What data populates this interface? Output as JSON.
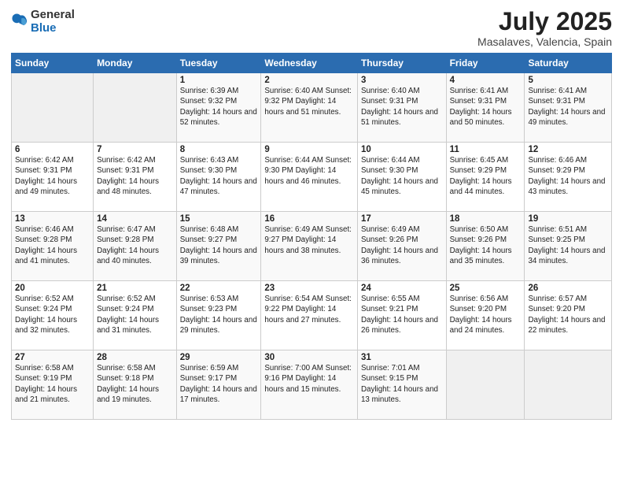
{
  "header": {
    "logo_general": "General",
    "logo_blue": "Blue",
    "main_title": "July 2025",
    "subtitle": "Masalaves, Valencia, Spain"
  },
  "columns": [
    "Sunday",
    "Monday",
    "Tuesday",
    "Wednesday",
    "Thursday",
    "Friday",
    "Saturday"
  ],
  "rows": [
    [
      {
        "day": "",
        "info": ""
      },
      {
        "day": "",
        "info": ""
      },
      {
        "day": "1",
        "info": "Sunrise: 6:39 AM\nSunset: 9:32 PM\nDaylight: 14 hours and 52 minutes."
      },
      {
        "day": "2",
        "info": "Sunrise: 6:40 AM\nSunset: 9:32 PM\nDaylight: 14 hours and 51 minutes."
      },
      {
        "day": "3",
        "info": "Sunrise: 6:40 AM\nSunset: 9:31 PM\nDaylight: 14 hours and 51 minutes."
      },
      {
        "day": "4",
        "info": "Sunrise: 6:41 AM\nSunset: 9:31 PM\nDaylight: 14 hours and 50 minutes."
      },
      {
        "day": "5",
        "info": "Sunrise: 6:41 AM\nSunset: 9:31 PM\nDaylight: 14 hours and 49 minutes."
      }
    ],
    [
      {
        "day": "6",
        "info": "Sunrise: 6:42 AM\nSunset: 9:31 PM\nDaylight: 14 hours and 49 minutes."
      },
      {
        "day": "7",
        "info": "Sunrise: 6:42 AM\nSunset: 9:31 PM\nDaylight: 14 hours and 48 minutes."
      },
      {
        "day": "8",
        "info": "Sunrise: 6:43 AM\nSunset: 9:30 PM\nDaylight: 14 hours and 47 minutes."
      },
      {
        "day": "9",
        "info": "Sunrise: 6:44 AM\nSunset: 9:30 PM\nDaylight: 14 hours and 46 minutes."
      },
      {
        "day": "10",
        "info": "Sunrise: 6:44 AM\nSunset: 9:30 PM\nDaylight: 14 hours and 45 minutes."
      },
      {
        "day": "11",
        "info": "Sunrise: 6:45 AM\nSunset: 9:29 PM\nDaylight: 14 hours and 44 minutes."
      },
      {
        "day": "12",
        "info": "Sunrise: 6:46 AM\nSunset: 9:29 PM\nDaylight: 14 hours and 43 minutes."
      }
    ],
    [
      {
        "day": "13",
        "info": "Sunrise: 6:46 AM\nSunset: 9:28 PM\nDaylight: 14 hours and 41 minutes."
      },
      {
        "day": "14",
        "info": "Sunrise: 6:47 AM\nSunset: 9:28 PM\nDaylight: 14 hours and 40 minutes."
      },
      {
        "day": "15",
        "info": "Sunrise: 6:48 AM\nSunset: 9:27 PM\nDaylight: 14 hours and 39 minutes."
      },
      {
        "day": "16",
        "info": "Sunrise: 6:49 AM\nSunset: 9:27 PM\nDaylight: 14 hours and 38 minutes."
      },
      {
        "day": "17",
        "info": "Sunrise: 6:49 AM\nSunset: 9:26 PM\nDaylight: 14 hours and 36 minutes."
      },
      {
        "day": "18",
        "info": "Sunrise: 6:50 AM\nSunset: 9:26 PM\nDaylight: 14 hours and 35 minutes."
      },
      {
        "day": "19",
        "info": "Sunrise: 6:51 AM\nSunset: 9:25 PM\nDaylight: 14 hours and 34 minutes."
      }
    ],
    [
      {
        "day": "20",
        "info": "Sunrise: 6:52 AM\nSunset: 9:24 PM\nDaylight: 14 hours and 32 minutes."
      },
      {
        "day": "21",
        "info": "Sunrise: 6:52 AM\nSunset: 9:24 PM\nDaylight: 14 hours and 31 minutes."
      },
      {
        "day": "22",
        "info": "Sunrise: 6:53 AM\nSunset: 9:23 PM\nDaylight: 14 hours and 29 minutes."
      },
      {
        "day": "23",
        "info": "Sunrise: 6:54 AM\nSunset: 9:22 PM\nDaylight: 14 hours and 27 minutes."
      },
      {
        "day": "24",
        "info": "Sunrise: 6:55 AM\nSunset: 9:21 PM\nDaylight: 14 hours and 26 minutes."
      },
      {
        "day": "25",
        "info": "Sunrise: 6:56 AM\nSunset: 9:20 PM\nDaylight: 14 hours and 24 minutes."
      },
      {
        "day": "26",
        "info": "Sunrise: 6:57 AM\nSunset: 9:20 PM\nDaylight: 14 hours and 22 minutes."
      }
    ],
    [
      {
        "day": "27",
        "info": "Sunrise: 6:58 AM\nSunset: 9:19 PM\nDaylight: 14 hours and 21 minutes."
      },
      {
        "day": "28",
        "info": "Sunrise: 6:58 AM\nSunset: 9:18 PM\nDaylight: 14 hours and 19 minutes."
      },
      {
        "day": "29",
        "info": "Sunrise: 6:59 AM\nSunset: 9:17 PM\nDaylight: 14 hours and 17 minutes."
      },
      {
        "day": "30",
        "info": "Sunrise: 7:00 AM\nSunset: 9:16 PM\nDaylight: 14 hours and 15 minutes."
      },
      {
        "day": "31",
        "info": "Sunrise: 7:01 AM\nSunset: 9:15 PM\nDaylight: 14 hours and 13 minutes."
      },
      {
        "day": "",
        "info": ""
      },
      {
        "day": "",
        "info": ""
      }
    ]
  ]
}
